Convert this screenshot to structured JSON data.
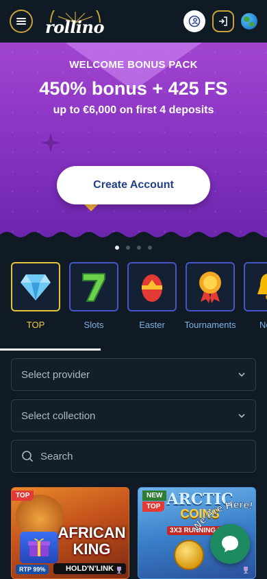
{
  "header": {
    "logo_text": "rollino",
    "menu_icon": "hamburger-icon",
    "profile_icon": "user-swap-icon",
    "login_icon": "login-icon",
    "language_icon": "globe-icon"
  },
  "hero": {
    "title": "WELCOME BONUS PACK",
    "bonus": "450% bonus + 425 FS",
    "subtitle": "up to €6,000 on first 4 deposits",
    "cta_label": "Create Account"
  },
  "carousel": {
    "slides": 4,
    "active_index": 0
  },
  "categories": [
    {
      "label": "TOP",
      "icon": "diamond-icon",
      "active": true
    },
    {
      "label": "Slots",
      "icon": "lucky-seven-icon",
      "active": false
    },
    {
      "label": "Easter",
      "icon": "easter-egg-icon",
      "active": false
    },
    {
      "label": "Tournaments",
      "icon": "medal-icon",
      "active": false
    },
    {
      "label": "New",
      "icon": "bell-icon",
      "active": false
    }
  ],
  "filters": {
    "provider_placeholder": "Select provider",
    "collection_placeholder": "Select collection",
    "search_placeholder": "Search"
  },
  "games": [
    {
      "badge": "TOP",
      "title_line1": "AFRICAN",
      "title_line2": "KING",
      "subtitle": "HOLD'N'LINK",
      "rtp": "RTP 99%"
    },
    {
      "badge_new": "NEW",
      "badge_top": "TOP",
      "title_line1": "ARCTIC",
      "title_line2": "COINS",
      "subtitle": "3X3 RUNNING WINS"
    }
  ],
  "chat_widget": {
    "label": "We Are Here!"
  },
  "colors": {
    "background": "#0f1a24",
    "accent_gold": "#c9a23a",
    "hero_purple": "#8a35c4",
    "cta_text": "#1f3e8a",
    "active_category": "#f2d23b",
    "category_text": "#7fb3e6",
    "chat_green": "#1e8a60"
  }
}
